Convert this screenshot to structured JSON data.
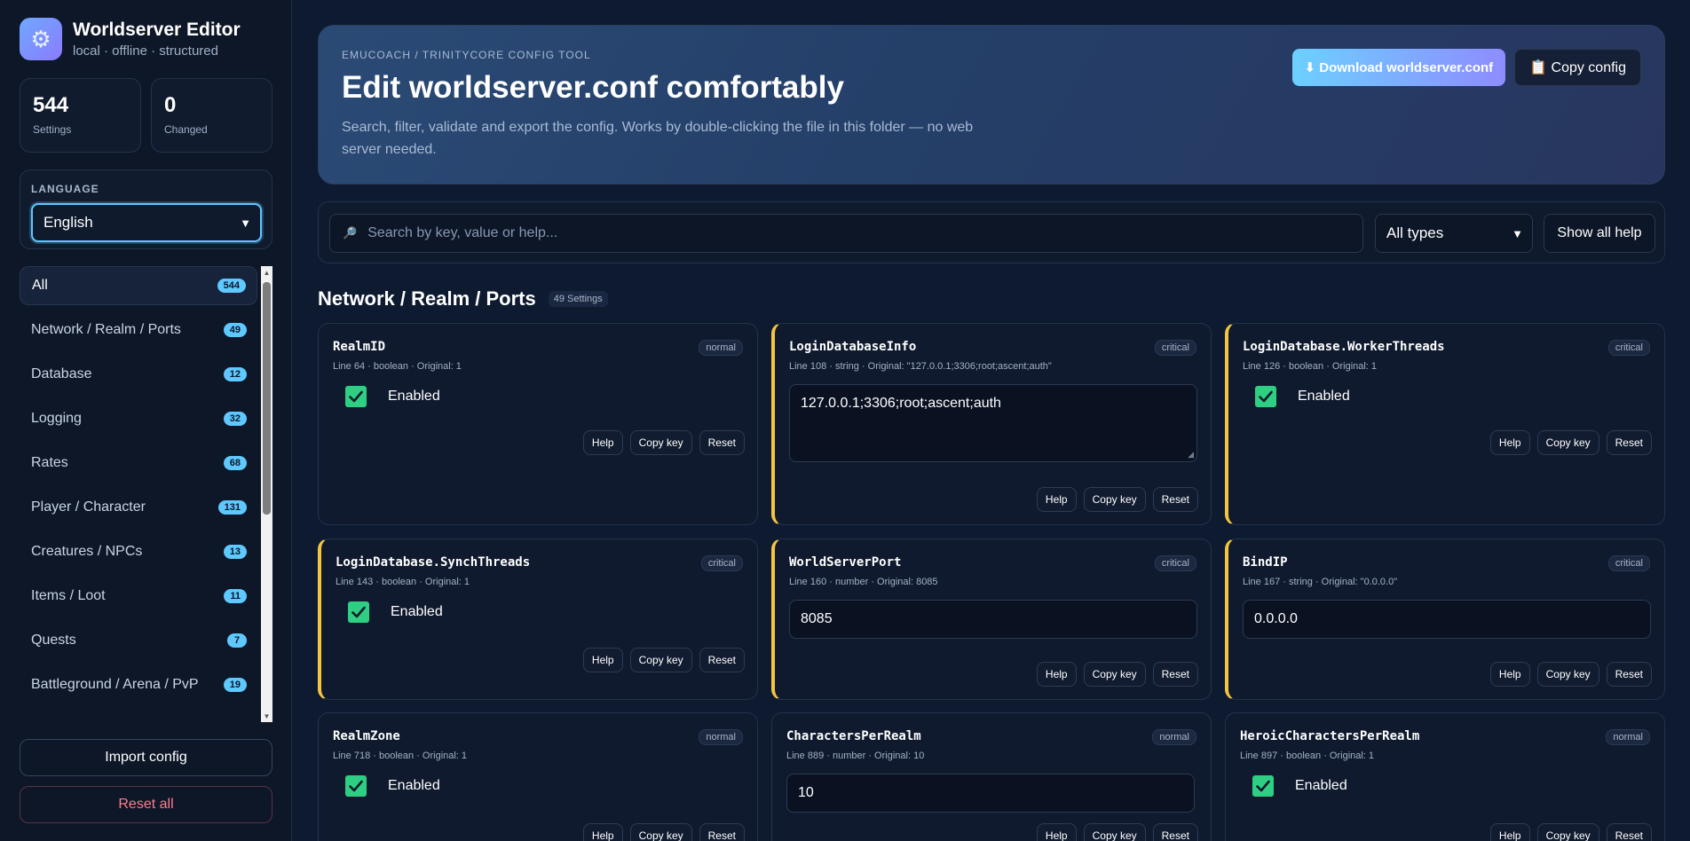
{
  "brand": {
    "icon": "gear-icon",
    "title": "Worldserver Editor",
    "subtitle": "local · offline · structured"
  },
  "stats": [
    {
      "value": "544",
      "label": "Settings"
    },
    {
      "value": "0",
      "label": "Changed"
    }
  ],
  "language": {
    "label": "LANGUAGE",
    "selected": "English"
  },
  "nav": [
    {
      "label": "All",
      "count": "544"
    },
    {
      "label": "Network / Realm / Ports",
      "count": "49"
    },
    {
      "label": "Database",
      "count": "12"
    },
    {
      "label": "Logging",
      "count": "32"
    },
    {
      "label": "Rates",
      "count": "68"
    },
    {
      "label": "Player / Character",
      "count": "131"
    },
    {
      "label": "Creatures / NPCs",
      "count": "13"
    },
    {
      "label": "Items / Loot",
      "count": "11"
    },
    {
      "label": "Quests",
      "count": "7"
    },
    {
      "label": "Battleground / Arena / PvP",
      "count": "19"
    }
  ],
  "sidebar_actions": {
    "import": "Import config",
    "reset_all": "Reset all"
  },
  "hero": {
    "eyebrow": "EMUCOACH / TRINITYCORE CONFIG TOOL",
    "title": "Edit worldserver.conf comfortably",
    "description": "Search, filter, validate and export the config. Works by double-clicking the file in this folder — no web server needed.",
    "download_label": "⬇ Download worldserver.conf",
    "copy_label": "📋 Copy config"
  },
  "toolbar": {
    "search_placeholder": "Search by key, value or help...",
    "type_filter": "All types",
    "show_help": "Show all help"
  },
  "section": {
    "title": "Network / Realm / Ports",
    "count": "49 Settings"
  },
  "card_actions": {
    "help": "Help",
    "copy_key": "Copy key",
    "reset": "Reset"
  },
  "cards": [
    {
      "key": "RealmID",
      "meta": "Line 64 · boolean · Original: 1",
      "tag": "normal",
      "control": "checkbox",
      "value": "Enabled"
    },
    {
      "key": "LoginDatabaseInfo",
      "meta": "Line 108 · string · Original: \"127.0.0.1;3306;root;ascent;auth\"",
      "tag": "critical",
      "control": "textarea",
      "value": "127.0.0.1;3306;root;ascent;auth"
    },
    {
      "key": "LoginDatabase.WorkerThreads",
      "meta": "Line 126 · boolean · Original: 1",
      "tag": "critical",
      "control": "checkbox",
      "value": "Enabled"
    },
    {
      "key": "LoginDatabase.SynchThreads",
      "meta": "Line 143 · boolean · Original: 1",
      "tag": "critical",
      "control": "checkbox",
      "value": "Enabled"
    },
    {
      "key": "WorldServerPort",
      "meta": "Line 160 · number · Original: 8085",
      "tag": "critical",
      "control": "input",
      "value": "8085"
    },
    {
      "key": "BindIP",
      "meta": "Line 167 · string · Original: \"0.0.0.0\"",
      "tag": "critical",
      "control": "input",
      "value": "0.0.0.0"
    },
    {
      "key": "RealmZone",
      "meta": "Line 718 · boolean · Original: 1",
      "tag": "normal",
      "control": "checkbox",
      "value": "Enabled"
    },
    {
      "key": "CharactersPerRealm",
      "meta": "Line 889 · number · Original: 10",
      "tag": "normal",
      "control": "input",
      "value": "10"
    },
    {
      "key": "HeroicCharactersPerRealm",
      "meta": "Line 897 · boolean · Original: 1",
      "tag": "normal",
      "control": "checkbox",
      "value": "Enabled"
    }
  ]
}
